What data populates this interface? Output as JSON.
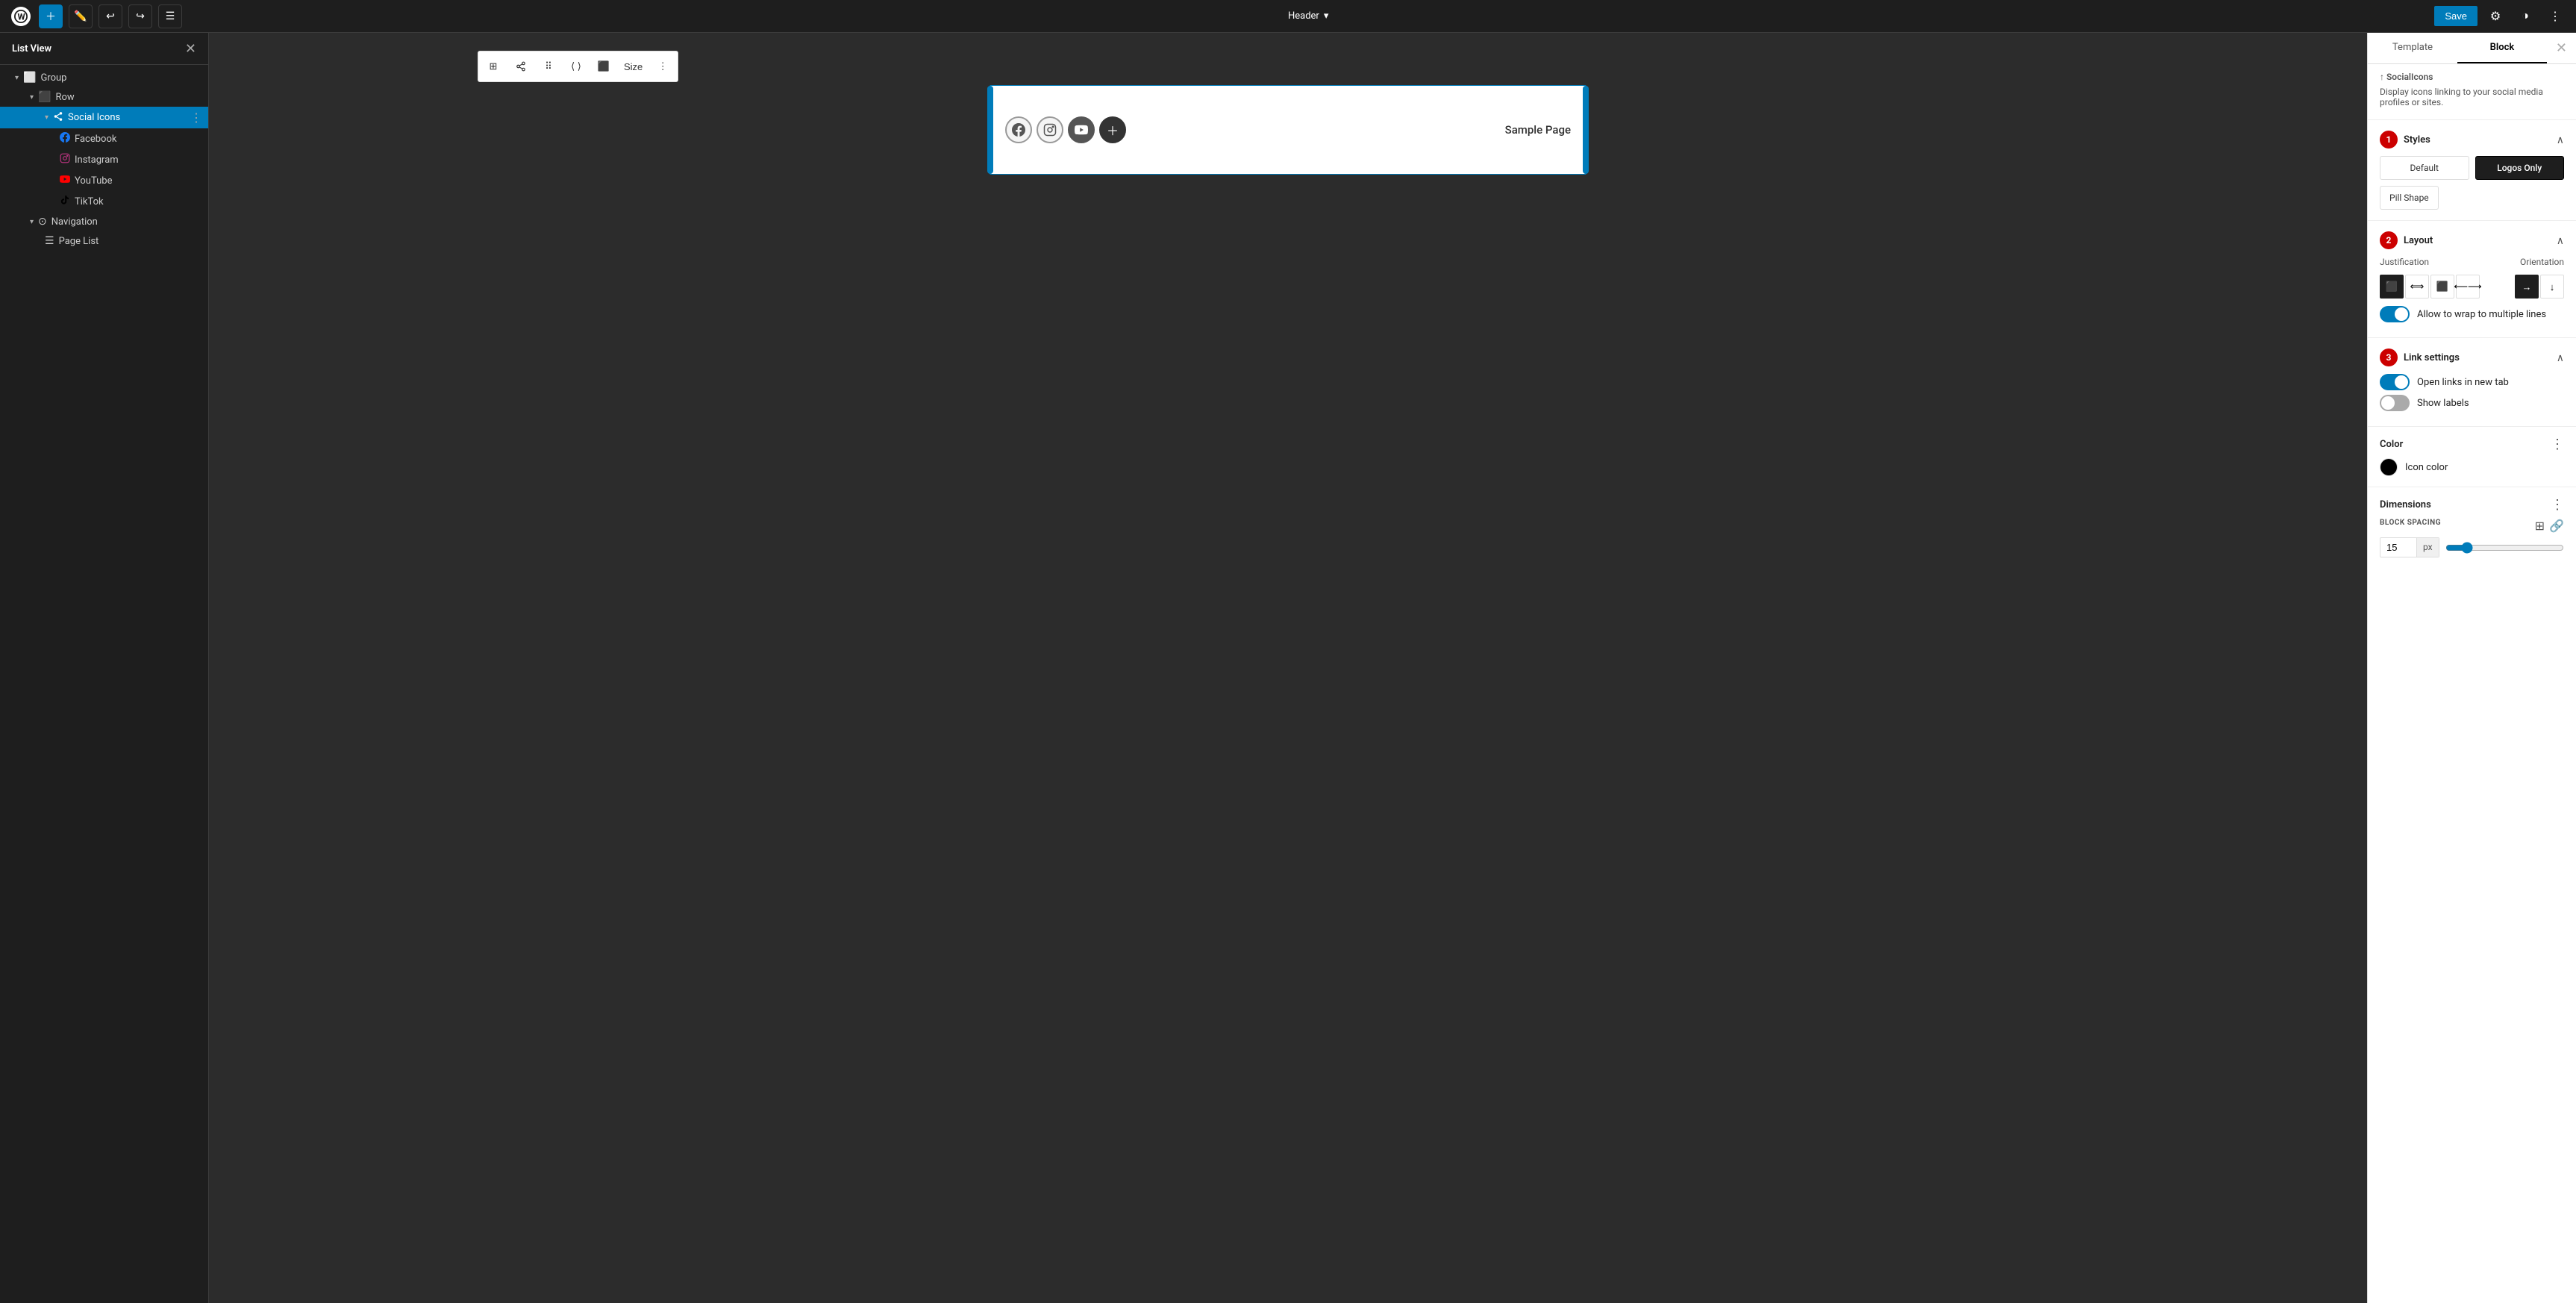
{
  "topbar": {
    "header_label": "Header",
    "save_label": "Save"
  },
  "sidebar": {
    "title": "List View",
    "items": [
      {
        "id": "group",
        "label": "Group",
        "icon": "⬜",
        "indent": 1,
        "chevron": true,
        "type": "group"
      },
      {
        "id": "row",
        "label": "Row",
        "icon": "⬜",
        "indent": 2,
        "chevron": true,
        "type": "row"
      },
      {
        "id": "social-icons",
        "label": "Social Icons",
        "indent": 3,
        "chevron": true,
        "active": true
      },
      {
        "id": "facebook",
        "label": "Facebook",
        "indent": 4
      },
      {
        "id": "instagram",
        "label": "Instagram",
        "indent": 4
      },
      {
        "id": "youtube",
        "label": "YouTube",
        "indent": 4
      },
      {
        "id": "tiktok",
        "label": "TikTok",
        "indent": 4
      },
      {
        "id": "navigation",
        "label": "Navigation",
        "indent": 2,
        "chevron": true
      },
      {
        "id": "page-list",
        "label": "Page List",
        "indent": 3
      }
    ]
  },
  "canvas": {
    "sample_page_label": "Sample Page",
    "toolbar": {
      "size_label": "Size"
    }
  },
  "rightPanel": {
    "tabs": [
      "Template",
      "Block"
    ],
    "activeTab": "Block",
    "socialIconsDesc": "Display icons linking to your social media profiles or sites.",
    "sections": {
      "styles": {
        "number": "1",
        "title": "Styles",
        "buttons": [
          "Default",
          "Logos Only",
          "Pill Shape"
        ]
      },
      "layout": {
        "number": "2",
        "title": "Layout",
        "justification_label": "Justification",
        "orientation_label": "Orientation",
        "wrap_label": "Allow to wrap to multiple lines"
      },
      "linkSettings": {
        "number": "3",
        "title": "Link settings",
        "open_new_tab_label": "Open links in new tab",
        "show_labels_label": "Show labels"
      },
      "color": {
        "title": "Color",
        "icon_color_label": "Icon color"
      },
      "dimensions": {
        "title": "Dimensions",
        "spacing_label": "BLOCK SPACING",
        "spacing_value": "15",
        "spacing_unit": "px"
      }
    }
  }
}
